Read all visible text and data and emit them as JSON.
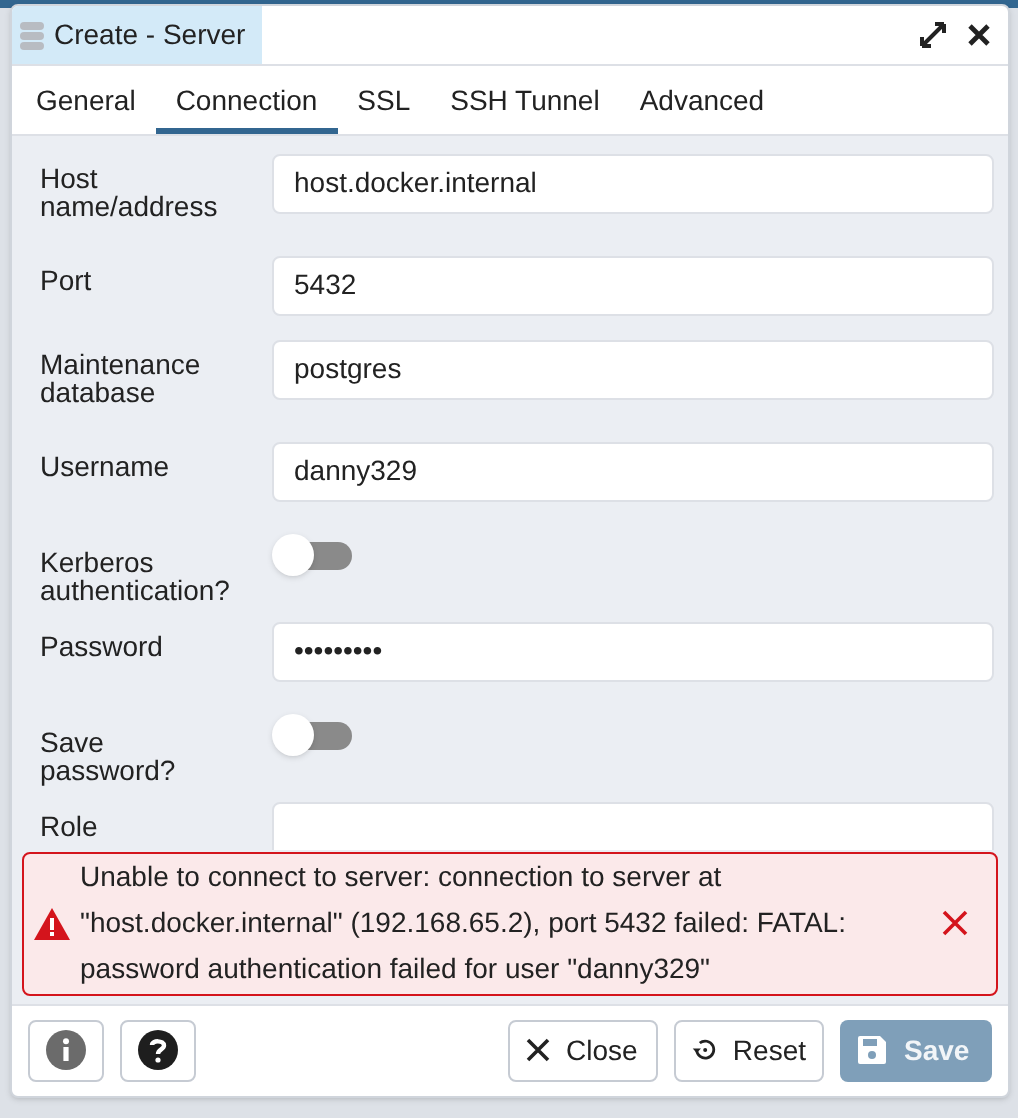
{
  "window": {
    "title": "Create - Server"
  },
  "tabs": [
    {
      "label": "General",
      "selected": false
    },
    {
      "label": "Connection",
      "selected": true
    },
    {
      "label": "SSL",
      "selected": false
    },
    {
      "label": "SSH Tunnel",
      "selected": false
    },
    {
      "label": "Advanced",
      "selected": false
    }
  ],
  "fields": [
    {
      "kind": "text",
      "label": "Host name/address",
      "value": "host.docker.internal"
    },
    {
      "kind": "text",
      "label": "Port",
      "value": "5432"
    },
    {
      "kind": "text",
      "label": "Maintenance database",
      "value": "postgres"
    },
    {
      "kind": "text",
      "label": "Username",
      "value": "danny329"
    },
    {
      "kind": "toggle",
      "label": "Kerberos authentication?",
      "on": false
    },
    {
      "kind": "text",
      "label": "Password",
      "value": "•••••••••"
    },
    {
      "kind": "toggle",
      "label": "Save password?",
      "on": false
    },
    {
      "kind": "text",
      "label": "Role"
    }
  ],
  "error": {
    "message": "Unable to connect to server: connection to server at \"host.docker.internal\" (192.168.65.2), port 5432 failed: FATAL: password authentication failed for user \"danny329\""
  },
  "footer": {
    "buttons": [
      {
        "kind": "close",
        "label": "Close",
        "disabled": false
      },
      {
        "kind": "reset",
        "label": "Reset",
        "disabled": false
      },
      {
        "kind": "save",
        "label": "Save",
        "disabled": true
      }
    ]
  }
}
